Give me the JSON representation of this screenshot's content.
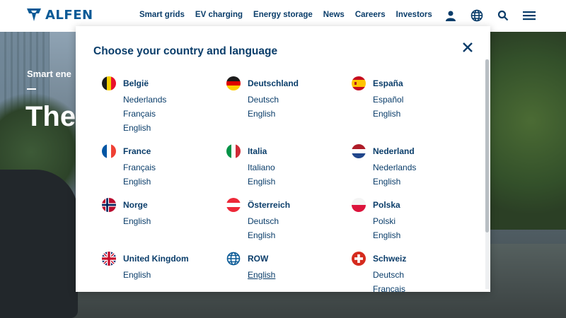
{
  "header": {
    "brand": "ALFEN",
    "nav": [
      "Smart grids",
      "EV charging",
      "Energy storage",
      "News",
      "Careers",
      "Investors"
    ]
  },
  "hero": {
    "small_title": "Smart ene",
    "big_title": "The"
  },
  "modal": {
    "title": "Choose your country and language",
    "countries": [
      {
        "name": "België",
        "flag": "belgium-flag",
        "languages": [
          "Nederlands",
          "Français",
          "English"
        ]
      },
      {
        "name": "Deutschland",
        "flag": "germany-flag",
        "languages": [
          "Deutsch",
          "English"
        ]
      },
      {
        "name": "España",
        "flag": "spain-flag",
        "languages": [
          "Español",
          "English"
        ]
      },
      {
        "name": "France",
        "flag": "france-flag",
        "languages": [
          "Français",
          "English"
        ]
      },
      {
        "name": "Italia",
        "flag": "italy-flag",
        "languages": [
          "Italiano",
          "English"
        ]
      },
      {
        "name": "Nederland",
        "flag": "netherlands-flag",
        "languages": [
          "Nederlands",
          "English"
        ]
      },
      {
        "name": "Norge",
        "flag": "norway-flag",
        "languages": [
          "English"
        ]
      },
      {
        "name": "Österreich",
        "flag": "austria-flag",
        "languages": [
          "Deutsch",
          "English"
        ]
      },
      {
        "name": "Polska",
        "flag": "poland-flag",
        "languages": [
          "Polski",
          "English"
        ]
      },
      {
        "name": "United Kingdom",
        "flag": "uk-flag",
        "languages": [
          "English"
        ]
      },
      {
        "name": "ROW",
        "flag": "globe-icon",
        "languages": [
          "English"
        ]
      },
      {
        "name": "Schweiz",
        "flag": "switzerland-flag",
        "languages": [
          "Deutsch",
          "Français"
        ]
      }
    ]
  },
  "colors": {
    "brand": "#0a5a96",
    "text": "#0a3d6a"
  }
}
